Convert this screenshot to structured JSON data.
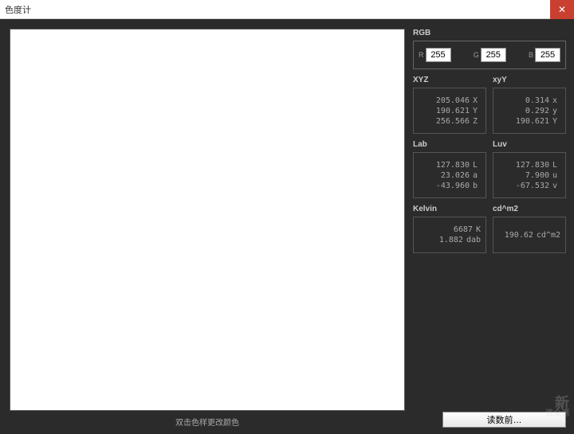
{
  "window": {
    "title": "色度计"
  },
  "swatch_hint": "双击色样更改颜色",
  "rgb": {
    "label": "RGB",
    "r_label": "R",
    "r": "255",
    "g_label": "G",
    "g": "255",
    "b_label": "B",
    "b": "255"
  },
  "xyz": {
    "label": "XYZ",
    "x": "205.046",
    "x_u": "X",
    "y": "190.621",
    "y_u": "Y",
    "z": "256.566",
    "z_u": "Z"
  },
  "xyy": {
    "label": "xyY",
    "x": "0.314",
    "x_u": "x",
    "y": "0.292",
    "y_u": "y",
    "Y": "190.621",
    "Y_u": "Y"
  },
  "lab": {
    "label": "Lab",
    "l": "127.830",
    "l_u": "L",
    "a": "23.026",
    "a_u": "a",
    "b": "-43.960",
    "b_u": "b"
  },
  "luv": {
    "label": "Luv",
    "l": "127.830",
    "l_u": "L",
    "u": "7.900",
    "u_u": "u",
    "v": "-67.532",
    "v_u": "v"
  },
  "kelvin": {
    "label": "Kelvin",
    "k": "6687",
    "k_u": "K",
    "d": "1.882",
    "d_u": "dab"
  },
  "cdm2": {
    "label": "cd^m2",
    "v": "190.62",
    "v_u": "cd^m2"
  },
  "action_button": "读数前…",
  "watermark": {
    "line1": "新",
    "line2": "浪众测"
  }
}
